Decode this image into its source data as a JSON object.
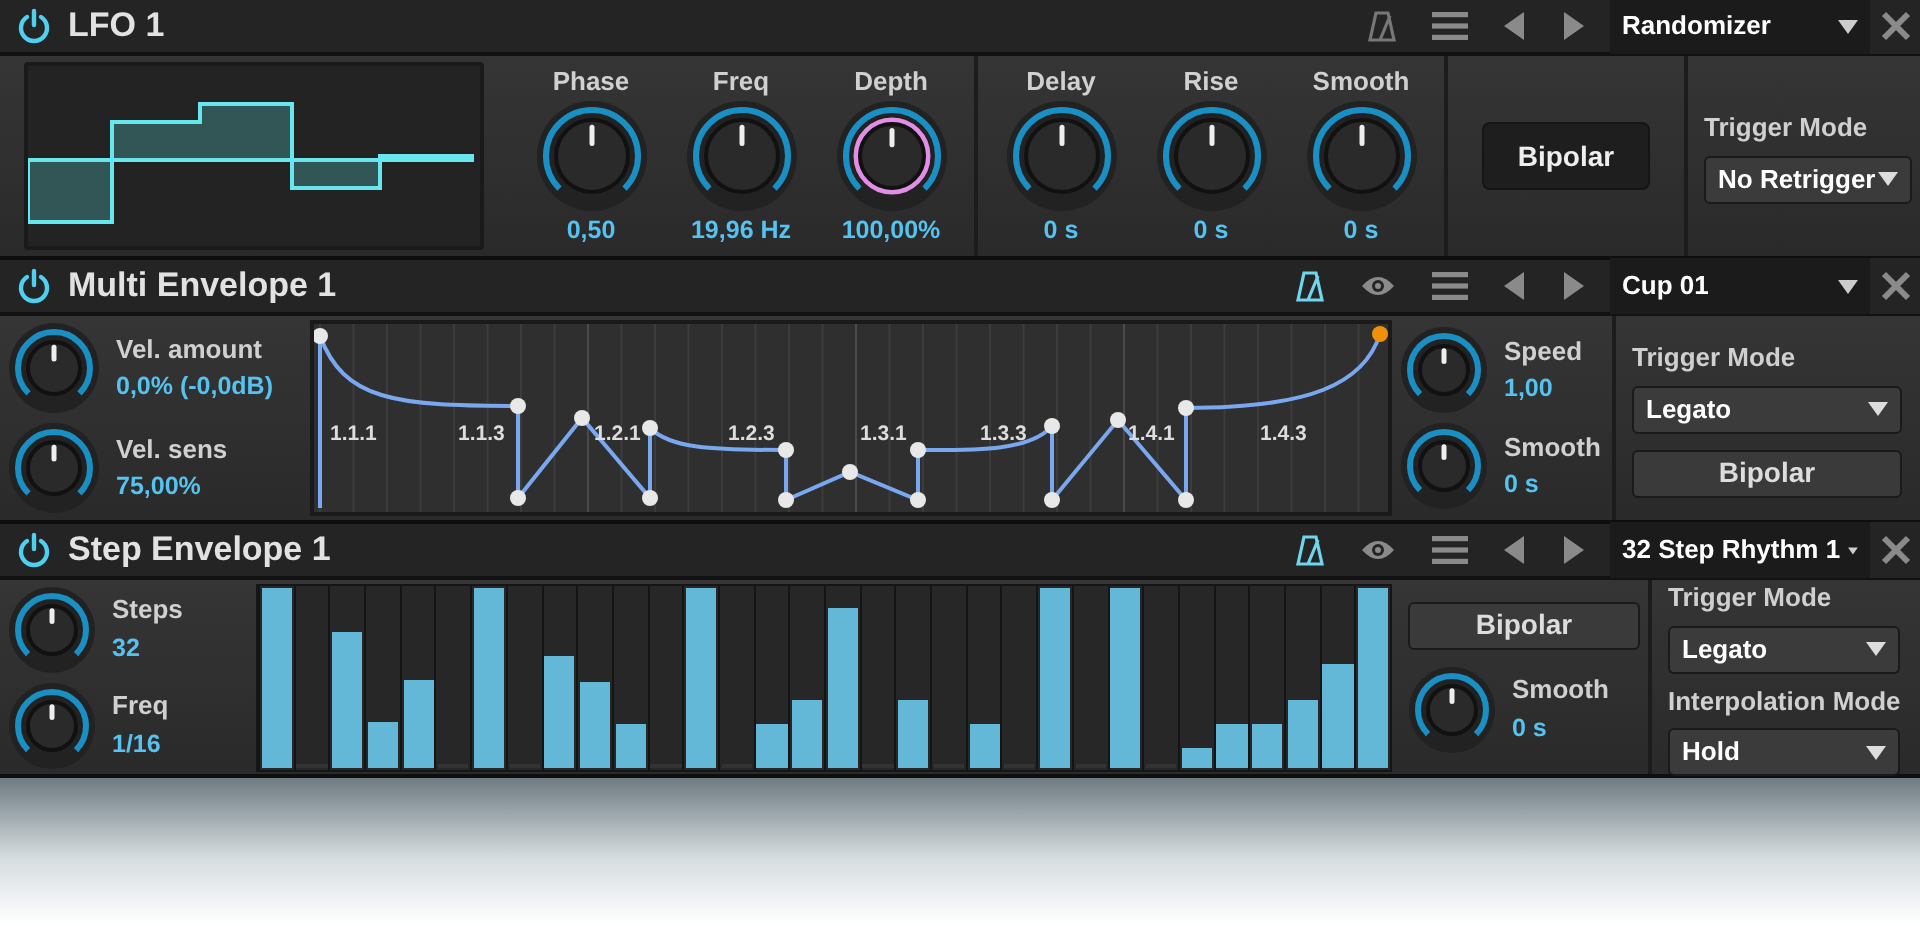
{
  "modules": [
    {
      "kind": "lfo",
      "title": "LFO 1",
      "power": true,
      "sync": false,
      "eye": false,
      "preset": "Randomizer",
      "knob_groups": [
        [
          {
            "label": "Phase",
            "value": "0,50",
            "modulated": false
          },
          {
            "label": "Freq",
            "value": "19,96 Hz",
            "modulated": false
          },
          {
            "label": "Depth",
            "value": "100,00%",
            "modulated": true
          }
        ],
        [
          {
            "label": "Delay",
            "value": "0 s",
            "modulated": false
          },
          {
            "label": "Rise",
            "value": "0 s",
            "modulated": false
          },
          {
            "label": "Smooth",
            "value": "0 s",
            "modulated": false
          }
        ]
      ],
      "bipolar": {
        "label": "Bipolar"
      },
      "trigger_mode": {
        "label": "Trigger Mode",
        "value": "No Retrigger"
      }
    },
    {
      "kind": "multi_envelope",
      "title": "Multi Envelope 1",
      "power": true,
      "sync": true,
      "eye": true,
      "preset": "Cup 01",
      "left_knobs": [
        {
          "label": "Vel. amount",
          "value": "0,0% (-0,0dB)"
        },
        {
          "label": "Vel. sens",
          "value": "75,00%"
        }
      ],
      "graph_labels": [
        "1.1.1",
        "1.1.3",
        "1.2.1",
        "1.2.3",
        "1.3.1",
        "1.3.3",
        "1.4.1",
        "1.4.3"
      ],
      "right_knobs": [
        {
          "label": "Speed",
          "value": "1,00"
        },
        {
          "label": "Smooth",
          "value": "0 s"
        }
      ],
      "trigger_mode": {
        "label": "Trigger Mode",
        "value": "Legato"
      },
      "bipolar": {
        "label": "Bipolar"
      }
    },
    {
      "kind": "step_envelope",
      "title": "Step Envelope 1",
      "power": true,
      "sync": true,
      "eye": true,
      "preset": "32 Step Rhythm 1",
      "left_knobs": [
        {
          "label": "Steps",
          "value": "32"
        },
        {
          "label": "Freq",
          "value": "1/16"
        }
      ],
      "steps": [
        {
          "level": 1
        },
        {
          "level": 0
        },
        {
          "level": 0.75
        },
        {
          "level": 0.25
        },
        {
          "level": 0.48
        },
        {
          "level": 0
        },
        {
          "level": 1
        },
        {
          "level": 0
        },
        {
          "level": 0.62
        },
        {
          "level": 0.47
        },
        {
          "level": 0.24
        },
        {
          "level": 0
        },
        {
          "level": 1
        },
        {
          "level": 0
        },
        {
          "level": 0.24
        },
        {
          "level": 0.37
        },
        {
          "level": 0.88
        },
        {
          "level": 0
        },
        {
          "level": 0.37
        },
        {
          "level": 0
        },
        {
          "level": 0.24
        },
        {
          "level": 0
        },
        {
          "level": 1
        },
        {
          "level": 0
        },
        {
          "level": 1
        },
        {
          "level": 0
        },
        {
          "level": 0.11
        },
        {
          "level": 0.24
        },
        {
          "level": 0.24
        },
        {
          "level": 0.37
        },
        {
          "level": 0.57
        },
        {
          "level": 1
        }
      ],
      "bipolar": {
        "label": "Bipolar"
      },
      "right_knobs": [
        {
          "label": "Smooth",
          "value": "0 s"
        }
      ],
      "trigger_mode": {
        "label": "Trigger Mode",
        "value": "Legato"
      },
      "interpolation_mode": {
        "label": "Interpolation Mode",
        "value": "Hold"
      }
    }
  ]
}
